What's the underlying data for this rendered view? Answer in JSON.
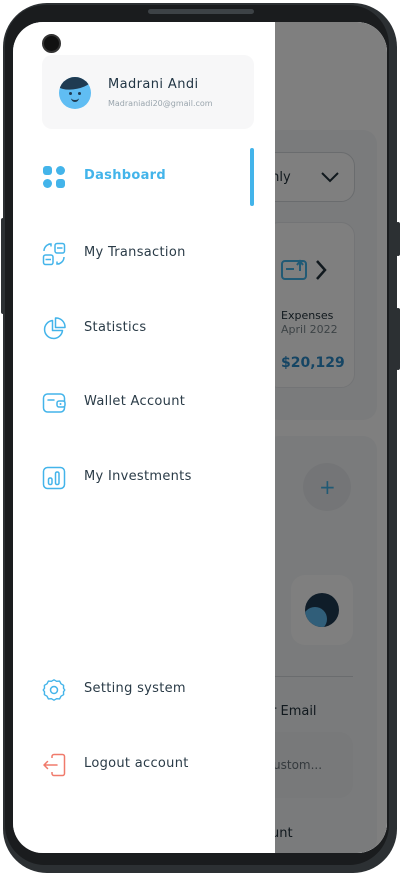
{
  "profile": {
    "name": "Madrani Andi",
    "email": "Madraniadi20@gmail.com"
  },
  "menu": [
    {
      "label": "Dashboard",
      "icon": "dashboard-grid-icon",
      "active": true
    },
    {
      "label": "My Transaction",
      "icon": "transaction-icon",
      "active": false
    },
    {
      "label": "Statistics",
      "icon": "pie-chart-icon",
      "active": false
    },
    {
      "label": "Wallet Account",
      "icon": "wallet-icon",
      "active": false
    },
    {
      "label": "My Investments",
      "icon": "investments-icon",
      "active": false
    }
  ],
  "bottom_menu": [
    {
      "label": "Setting system",
      "icon": "gear-icon"
    },
    {
      "label": "Logout account",
      "icon": "logout-icon"
    }
  ],
  "background": {
    "period_partial": "thly",
    "expenses_label": "Expenses",
    "expenses_date": "April 2022",
    "expenses_amount": "$20,129",
    "add_symbol": "+",
    "email_partial": "r Email",
    "input_partial": "ustom...",
    "bottom_partial": "unt"
  },
  "colors": {
    "accent": "#43b4ea",
    "logout": "#f07a6b",
    "text": "#2a3b47"
  }
}
